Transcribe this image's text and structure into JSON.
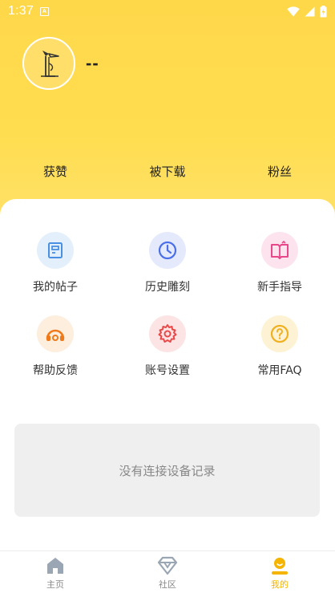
{
  "status_bar": {
    "time": "1:37",
    "notification_glyph": "A"
  },
  "profile": {
    "username": "--",
    "avatar_icon": "woodpecker-logo"
  },
  "stats": [
    {
      "label": "获赞"
    },
    {
      "label": "被下载"
    },
    {
      "label": "粉丝"
    }
  ],
  "menu": [
    {
      "label": "我的帖子",
      "icon": "document-icon",
      "color": "#4a90e2"
    },
    {
      "label": "历史雕刻",
      "icon": "clock-icon",
      "color": "#4a6fe8"
    },
    {
      "label": "新手指导",
      "icon": "book-icon",
      "color": "#e8488a"
    },
    {
      "label": "帮助反馈",
      "icon": "headset-icon",
      "color": "#f07a1a"
    },
    {
      "label": "账号设置",
      "icon": "gear-icon",
      "color": "#e84a4a"
    },
    {
      "label": "常用FAQ",
      "icon": "question-icon",
      "color": "#f0b020"
    }
  ],
  "empty_state": {
    "text": "没有连接设备记录"
  },
  "bottom_nav": [
    {
      "label": "主页",
      "icon": "home-icon",
      "active": false
    },
    {
      "label": "社区",
      "icon": "diamond-icon",
      "active": false
    },
    {
      "label": "我的",
      "icon": "user-icon",
      "active": true
    }
  ],
  "colors": {
    "header_yellow": "#ffd84a",
    "active_nav": "#f5b400"
  }
}
